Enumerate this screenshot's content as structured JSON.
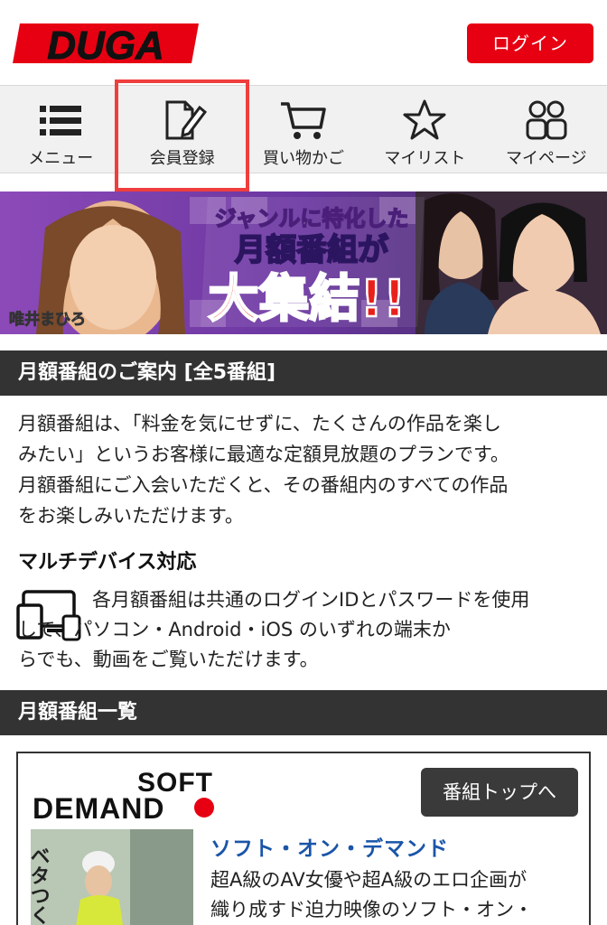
{
  "header": {
    "logo_text": "DUGA",
    "login_label": "ログイン"
  },
  "nav": {
    "items": [
      {
        "label": "メニュー",
        "icon": "menu-icon"
      },
      {
        "label": "会員登録",
        "icon": "register-icon"
      },
      {
        "label": "買い物かご",
        "icon": "cart-icon"
      },
      {
        "label": "マイリスト",
        "icon": "star-icon"
      },
      {
        "label": "マイページ",
        "icon": "mypage-icon"
      }
    ]
  },
  "banner": {
    "headline_1": "ジャンルに特化した",
    "headline_2": "月額番組が",
    "headline_3": "大集結!!",
    "name_caption": "唯井まひろ"
  },
  "guide": {
    "section_title": "月額番組のご案内 [全5番組]",
    "line1": "月額番組は、「料金を気にせずに、たくさんの作品を楽し",
    "line2": "みたい」というお客様に最適な定額見放題のプランです。",
    "line3": "月額番組にご入会いただくと、その番組内のすべての作品",
    "line4": "をお楽しみいただけます。"
  },
  "multi_device": {
    "heading": "マルチデバイス対応",
    "line1": "各月額番組は共通のログインIDとパスワードを使用",
    "line2": "して、パソコン・Android・iOS のいずれの端末か",
    "line3": "らでも、動画をご覧いただけます。"
  },
  "list": {
    "section_title": "月額番組一覧",
    "card": {
      "logo_line1": "SOFT",
      "logo_line2": "DEMAND",
      "top_button": "番組トップへ",
      "title": "ソフト・オン・デマンド",
      "desc_line1": "超A級のAV女優や超A級のエロ企画が",
      "desc_line2": "織り成すド迫力映像のソフト・オン・",
      "thumb_text": "ベタつく髪"
    }
  },
  "colors": {
    "brand_red": "#e60012",
    "dark_bar": "#333333",
    "link_blue": "#1a55a8",
    "highlight": "#ef3e3e"
  }
}
